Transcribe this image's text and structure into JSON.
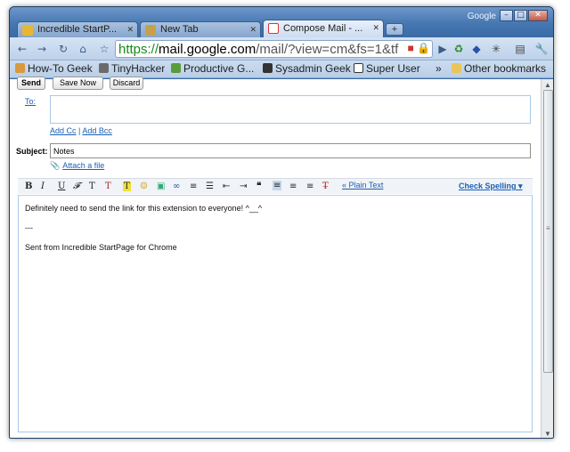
{
  "window": {
    "brand": "Google",
    "controls": {
      "minimize": "–",
      "maximize": "□",
      "close": "✕"
    }
  },
  "tabs": [
    {
      "title": "Incredible StartP...",
      "favicon_color": "#e9b632",
      "active": false
    },
    {
      "title": "New Tab",
      "favicon_color": "#c8a04b",
      "active": false
    },
    {
      "title": "Compose Mail - ...",
      "favicon_color": "#d33",
      "active": true
    }
  ],
  "new_tab_label": "+",
  "address": {
    "scheme": "https://",
    "host": "mail.google.com",
    "path": "/mail/?view=cm&fs=1&tf"
  },
  "bookmarks": {
    "items": [
      {
        "label": "How-To Geek",
        "icon_color": "#d89a3a"
      },
      {
        "label": "TinyHacker",
        "icon_color": "#6b6b6b"
      },
      {
        "label": "Productive G...",
        "icon_color": "#5a9c3b"
      },
      {
        "label": "Sysadmin Geek",
        "icon_color": "#333333"
      },
      {
        "label": "Super User",
        "icon_color": "#ffffff"
      }
    ],
    "overflow": "»",
    "other": "Other bookmarks"
  },
  "compose": {
    "send": "Send",
    "save_now": "Save Now",
    "discard": "Discard",
    "to_label": "To:",
    "add_cc": "Add Cc",
    "separator": "|",
    "add_bcc": "Add Bcc",
    "subject_label": "Subject:",
    "subject_value": "Notes",
    "attach": "Attach a file",
    "plain_text": "« Plain Text",
    "check_spelling": "Check Spelling ▾",
    "body": [
      "Definitely need to send the link for this extension to everyone! ^__^",
      "---",
      "Sent from Incredible StartPage for Chrome"
    ]
  }
}
